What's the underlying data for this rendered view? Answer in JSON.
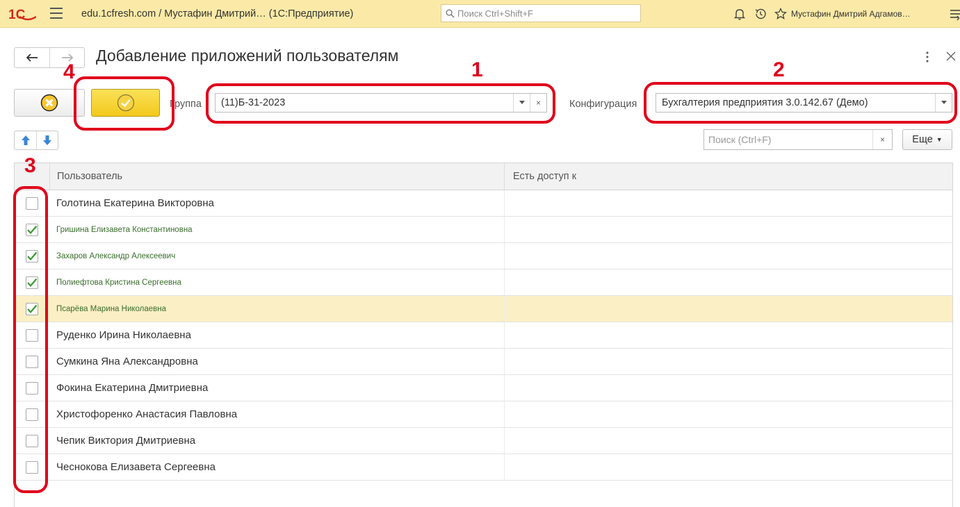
{
  "topbar": {
    "logo": "1С",
    "title": "edu.1cfresh.com / Мустафин Дмитрий…  (1С:Предприятие)",
    "search_placeholder": "Поиск Ctrl+Shift+F",
    "user": "Мустафин Дмитрий Адгамов…",
    "icons": [
      "bell-icon",
      "history-icon",
      "star-icon",
      "menu-icon"
    ]
  },
  "page": {
    "title": "Добавление приложений пользователям"
  },
  "toolbar": {
    "group_label": "Группа",
    "group_value": "(11)Б-31-2023",
    "config_label": "Конфигурация",
    "config_value": "Бухгалтерия предприятия 3.0.142.67 (Демо)",
    "clear_symbol": "×"
  },
  "list": {
    "search_placeholder": "Поиск (Ctrl+F)",
    "more_label": "Еще"
  },
  "table": {
    "columns": [
      "Пользователь",
      "Есть доступ к"
    ],
    "rows": [
      {
        "name": "Голотина Екатерина Викторовна",
        "checked": false
      },
      {
        "name": "Гришина Елизавета Константиновна",
        "checked": true
      },
      {
        "name": "Захаров Александр Алексеевич",
        "checked": true
      },
      {
        "name": "Полиефтова Кристина Сергеевна",
        "checked": true
      },
      {
        "name": "Псарёва Марина Николаевна",
        "checked": true,
        "selected": true
      },
      {
        "name": "Руденко Ирина Николаевна",
        "checked": false
      },
      {
        "name": "Сумкина Яна Александровна",
        "checked": false
      },
      {
        "name": "Фокина Екатерина Дмитриевна",
        "checked": false
      },
      {
        "name": "Христофоренко Анастасия Павловна",
        "checked": false
      },
      {
        "name": "Чепик Виктория Дмитриевна",
        "checked": false
      },
      {
        "name": "Чеснокова Елизавета Сергеевна",
        "checked": false
      }
    ]
  },
  "annotations": {
    "n1": "1",
    "n2": "2",
    "n3": "3",
    "n4": "4"
  },
  "colors": {
    "topbar": "#fbeaa7",
    "accent_yellow": "#f2c91c",
    "annotation_red": "#e0001b",
    "checked_text": "#3a6e2c",
    "selected_row": "#fbefc5"
  }
}
